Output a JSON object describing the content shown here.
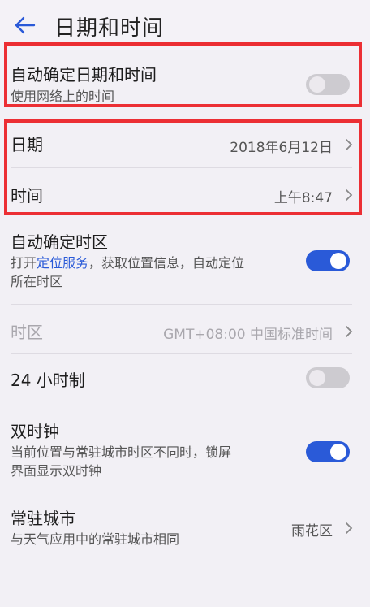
{
  "header": {
    "title": "日期和时间",
    "back_icon": "arrow-left-icon"
  },
  "auto_datetime": {
    "title": "自动确定日期和时间",
    "subtitle": "使用网络上的时间",
    "enabled": false
  },
  "date": {
    "title": "日期",
    "value": "2018年6月12日"
  },
  "time": {
    "title": "时间",
    "value": "上午8:47"
  },
  "auto_timezone": {
    "title": "自动确定时区",
    "subtitle_prefix": "打开",
    "subtitle_link": "定位服务",
    "subtitle_suffix": "，获取位置信息，自动定位",
    "subtitle_line2": "所在时区",
    "enabled": true
  },
  "timezone": {
    "title": "时区",
    "value": "GMT+08:00 中国标准时间",
    "disabled": true
  },
  "hour24": {
    "title": "24 小时制",
    "enabled": false
  },
  "dual_clock": {
    "title": "双时钟",
    "subtitle_line1": "当前位置与常驻城市时区不同时，锁屏",
    "subtitle_line2": "界面显示双时钟",
    "enabled": true
  },
  "home_city": {
    "title": "常驻城市",
    "subtitle": "与天气应用中的常驻城市相同",
    "value": "雨花区"
  },
  "colors": {
    "accent": "#2a5ad8",
    "highlight": "#ec2f34",
    "background": "#f2f0f5"
  }
}
